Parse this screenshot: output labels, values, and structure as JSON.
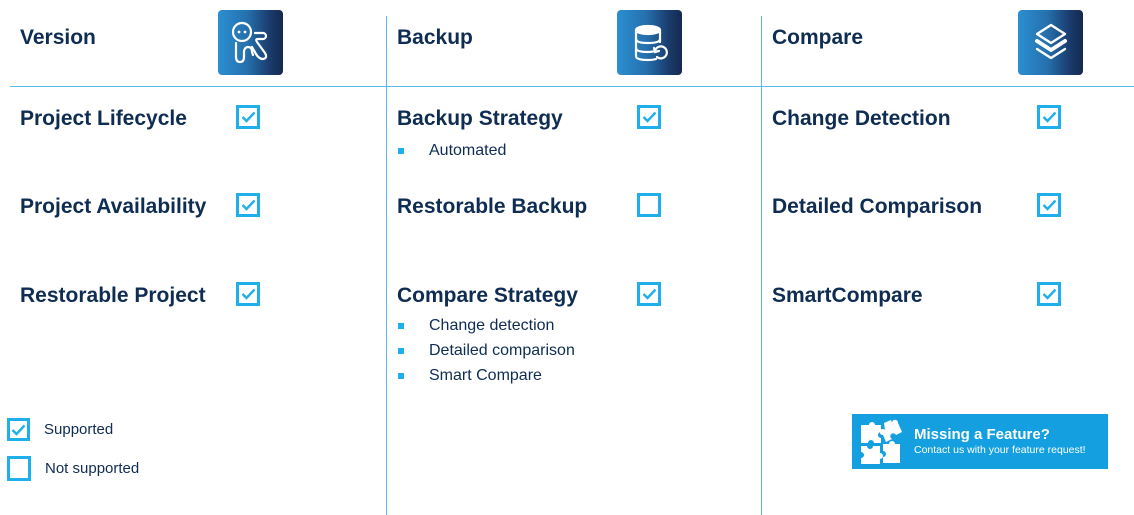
{
  "colors": {
    "text": "#0f2c52",
    "accent": "#1fb0ec",
    "divider": "#5bb8ea",
    "banner": "#14a0e0"
  },
  "columns": [
    {
      "title": "Version",
      "icon": "octopus-mascot-icon",
      "features": [
        {
          "label": "Project Lifecycle",
          "supported": true,
          "bullets": []
        },
        {
          "label": "Project Availability",
          "supported": true,
          "bullets": []
        },
        {
          "label": "Restorable Project",
          "supported": true,
          "bullets": []
        }
      ]
    },
    {
      "title": "Backup",
      "icon": "database-restore-icon",
      "features": [
        {
          "label": "Backup Strategy",
          "supported": true,
          "bullets": [
            "Automated"
          ]
        },
        {
          "label": "Restorable Backup",
          "supported": false,
          "bullets": []
        },
        {
          "label": "Compare Strategy",
          "supported": true,
          "bullets": [
            "Change detection",
            "Detailed comparison",
            "Smart Compare"
          ]
        }
      ]
    },
    {
      "title": "Compare",
      "icon": "layers-icon",
      "features": [
        {
          "label": "Change Detection",
          "supported": true,
          "bullets": []
        },
        {
          "label": "Detailed Comparison",
          "supported": true,
          "bullets": []
        },
        {
          "label": "SmartCompare",
          "supported": true,
          "bullets": []
        }
      ]
    }
  ],
  "legend": {
    "supported": "Supported",
    "not_supported": "Not supported"
  },
  "banner": {
    "icon": "puzzle-icon",
    "title": "Missing a Feature?",
    "subtitle": "Contact us with your feature request!"
  }
}
